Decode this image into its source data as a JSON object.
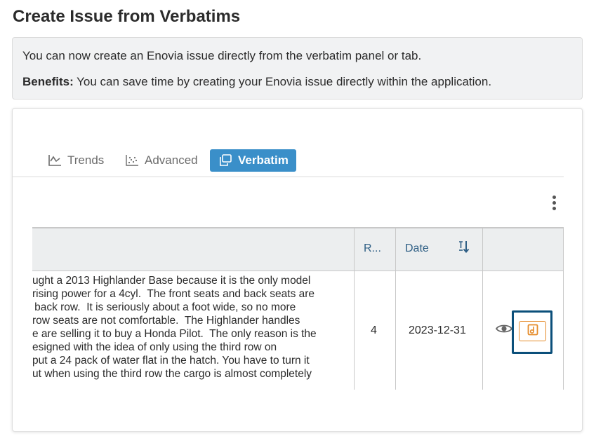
{
  "page": {
    "title": "Create Issue from Verbatims"
  },
  "info": {
    "line1": "You can now create an Enovia issue directly from the verbatim panel or tab.",
    "benefits_label": "Benefits:",
    "benefits_text": " You can save time by creating your Enovia issue directly within the application."
  },
  "tabs": [
    {
      "label": "Trends",
      "icon": "line-chart-icon",
      "active": false
    },
    {
      "label": "Advanced",
      "icon": "scatter-chart-icon",
      "active": false
    },
    {
      "label": "Verbatim",
      "icon": "verbatim-icon",
      "active": true
    }
  ],
  "menu": {
    "icon": "more-vertical-icon"
  },
  "table": {
    "columns": [
      {
        "label": ""
      },
      {
        "label": "R..."
      },
      {
        "label": "Date",
        "sort_icon": "sort-icon"
      },
      {
        "label": ""
      }
    ],
    "rows": [
      {
        "verbatim": "ught a 2013 Highlander Base because it is the only model\nrising power for a 4cyl.  The front seats and back seats are\n back row.  It is seriously about a foot wide, so no more\nrow seats are not comfortable.  The Highlander handles\ne are selling it to buy a Honda Pilot.  The only reason is the\nesigned with the idea of only using the third row on\nput a 24 pack of water flat in the hatch. You have to turn it\nut when using the third row the cargo is almost completely",
        "rating": "4",
        "date": "2023-12-31",
        "actions": [
          "eye-icon",
          "create-issue-icon"
        ]
      }
    ]
  },
  "colors": {
    "accent": "#3a8fc9",
    "issue_button_border": "#e58b2a",
    "highlight_border": "#0b4f7a"
  }
}
